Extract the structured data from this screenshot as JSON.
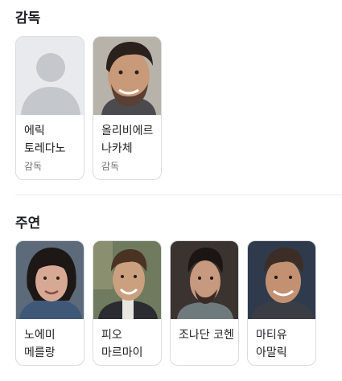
{
  "directors": {
    "title": "감독",
    "people": [
      {
        "name": "에릭 토레다노",
        "role": "감독",
        "photo": "placeholder-person-icon"
      },
      {
        "name": "올리비에르 나카체",
        "role": "감독",
        "photo": "person-photo"
      }
    ]
  },
  "cast": {
    "title": "주연",
    "people": [
      {
        "name": "노에미 메를랑",
        "photo": "person-photo"
      },
      {
        "name": "피오 마르마이",
        "photo": "person-photo"
      },
      {
        "name": "조나단 코헨",
        "photo": "person-photo"
      },
      {
        "name": "마티유 아말릭",
        "photo": "person-photo"
      }
    ]
  },
  "colors": {
    "placeholder_bg": "#e8eaed",
    "placeholder_fg": "#c4c7cc",
    "card_border": "#dadce0",
    "role_text": "#70757a"
  }
}
